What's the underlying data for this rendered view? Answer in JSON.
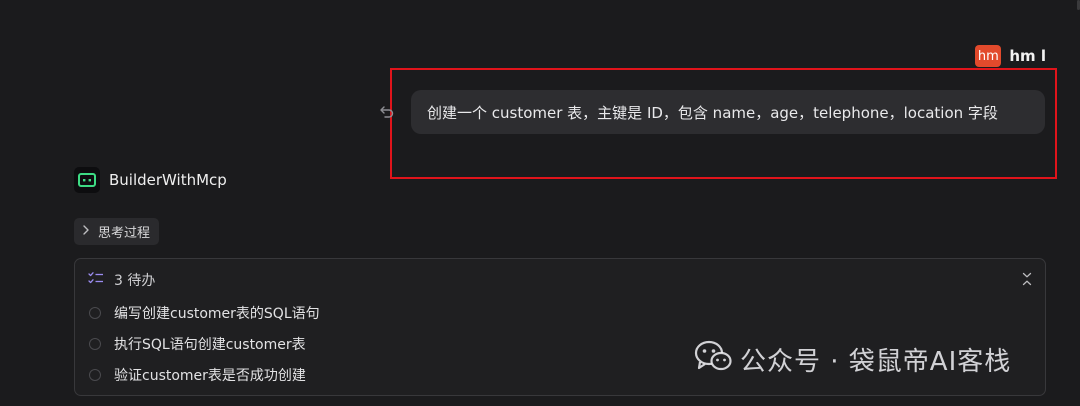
{
  "user": {
    "avatar_text": "hm",
    "name": "hm l"
  },
  "user_message": {
    "text": "创建一个 customer 表，主键是 ID，包含 name，age，telephone，location 字段"
  },
  "bot": {
    "name": "BuilderWithMcp",
    "avatar_icon": "terminal-robot-icon"
  },
  "thinking": {
    "label": "思考过程"
  },
  "todo": {
    "header": "3 待办",
    "items": [
      {
        "label": "编写创建customer表的SQL语句",
        "done": false
      },
      {
        "label": "执行SQL语句创建customer表",
        "done": false
      },
      {
        "label": "验证customer表是否成功创建",
        "done": false
      }
    ]
  },
  "watermark": {
    "text": "公众号 · 袋鼠帝AI客栈"
  },
  "colors": {
    "background": "#1b1b1d",
    "bubble": "#2d2d30",
    "highlight_border": "#e0141b",
    "user_avatar": "#e24a2c",
    "bot_accent": "#3ddc84",
    "todo_icon": "#9b8cf0"
  }
}
